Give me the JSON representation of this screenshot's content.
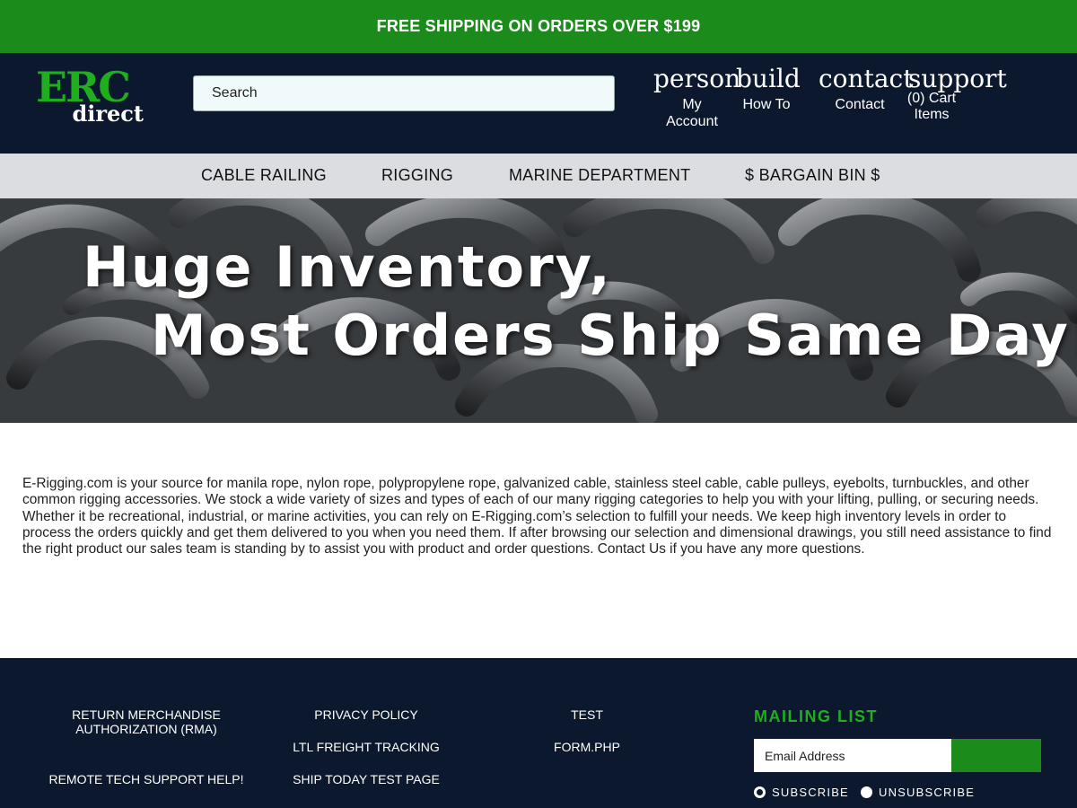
{
  "promo": {
    "text": "FREE SHIPPING ON ORDERS OVER $199"
  },
  "brand": {
    "logo_top": "ERC",
    "logo_bottom": "direct",
    "green": "#1fae1f",
    "navy": "#0c182d",
    "promo_green": "#1b8c1b"
  },
  "header": {
    "search_placeholder": "Search",
    "utility": {
      "account": {
        "icon_name": "person",
        "label_1": "My",
        "label_2": "Account"
      },
      "howto": {
        "icon_name": "build",
        "label": "How To"
      },
      "contact": {
        "icon_name": "contact",
        "label": "Contact"
      },
      "cart": {
        "icon_name": "support",
        "count": "(0)",
        "label_1": "Cart",
        "label_2": "Items"
      }
    }
  },
  "nav": {
    "items": [
      "CABLE RAILING",
      "RIGGING",
      "MARINE DEPARTMENT",
      "$ BARGAIN BIN $"
    ]
  },
  "hero": {
    "line_1": "Huge Inventory,",
    "line_2": "Most Orders Ship Same Day!"
  },
  "intro": {
    "text": "E-Rigging.com is your source for manila rope, nylon rope, polypropylene rope, galvanized cable, stainless steel cable, cable pulleys, eyebolts, turnbuckles, and other common rigging accessories. We stock a wide variety of sizes and types of each of our many rigging categories to help you with your lifting, pulling, or securing needs. Whether it be recreational, industrial, or marine activities, you can rely on E-Rigging.com’s selection to fulfill your needs. We keep high inventory levels in order to process the orders quickly and get them delivered to you when you need them. If after browsing our selection and dimensional drawings, you still need assistance to find the right product our sales team is standing by to assist you with product and order questions. Contact Us if you have any more questions."
  },
  "footer": {
    "col1": [
      "RETURN MERCHANDISE AUTHORIZATION (RMA)",
      "REMOTE TECH SUPPORT HELP!"
    ],
    "col2": [
      "PRIVACY POLICY",
      "LTL FREIGHT TRACKING",
      "SHIP TODAY TEST PAGE"
    ],
    "col3": [
      "TEST",
      "FORM.PHP"
    ],
    "mailing": {
      "title": "MAILING LIST",
      "placeholder": "Email Address",
      "subscribe": "SUBSCRIBE",
      "unsubscribe": "UNSUBSCRIBE",
      "selected": "subscribe"
    }
  }
}
